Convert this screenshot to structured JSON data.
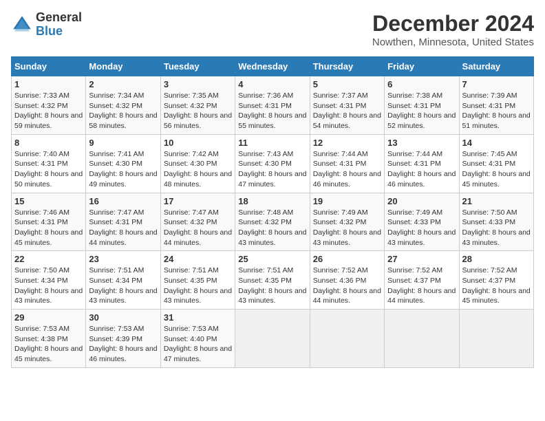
{
  "logo": {
    "general": "General",
    "blue": "Blue"
  },
  "title": "December 2024",
  "subtitle": "Nowthen, Minnesota, United States",
  "calendar": {
    "headers": [
      "Sunday",
      "Monday",
      "Tuesday",
      "Wednesday",
      "Thursday",
      "Friday",
      "Saturday"
    ],
    "weeks": [
      [
        {
          "day": "1",
          "sunrise": "7:33 AM",
          "sunset": "4:32 PM",
          "daylight": "8 hours and 59 minutes."
        },
        {
          "day": "2",
          "sunrise": "7:34 AM",
          "sunset": "4:32 PM",
          "daylight": "8 hours and 58 minutes."
        },
        {
          "day": "3",
          "sunrise": "7:35 AM",
          "sunset": "4:32 PM",
          "daylight": "8 hours and 56 minutes."
        },
        {
          "day": "4",
          "sunrise": "7:36 AM",
          "sunset": "4:31 PM",
          "daylight": "8 hours and 55 minutes."
        },
        {
          "day": "5",
          "sunrise": "7:37 AM",
          "sunset": "4:31 PM",
          "daylight": "8 hours and 54 minutes."
        },
        {
          "day": "6",
          "sunrise": "7:38 AM",
          "sunset": "4:31 PM",
          "daylight": "8 hours and 52 minutes."
        },
        {
          "day": "7",
          "sunrise": "7:39 AM",
          "sunset": "4:31 PM",
          "daylight": "8 hours and 51 minutes."
        }
      ],
      [
        {
          "day": "8",
          "sunrise": "7:40 AM",
          "sunset": "4:31 PM",
          "daylight": "8 hours and 50 minutes."
        },
        {
          "day": "9",
          "sunrise": "7:41 AM",
          "sunset": "4:30 PM",
          "daylight": "8 hours and 49 minutes."
        },
        {
          "day": "10",
          "sunrise": "7:42 AM",
          "sunset": "4:30 PM",
          "daylight": "8 hours and 48 minutes."
        },
        {
          "day": "11",
          "sunrise": "7:43 AM",
          "sunset": "4:30 PM",
          "daylight": "8 hours and 47 minutes."
        },
        {
          "day": "12",
          "sunrise": "7:44 AM",
          "sunset": "4:31 PM",
          "daylight": "8 hours and 46 minutes."
        },
        {
          "day": "13",
          "sunrise": "7:44 AM",
          "sunset": "4:31 PM",
          "daylight": "8 hours and 46 minutes."
        },
        {
          "day": "14",
          "sunrise": "7:45 AM",
          "sunset": "4:31 PM",
          "daylight": "8 hours and 45 minutes."
        }
      ],
      [
        {
          "day": "15",
          "sunrise": "7:46 AM",
          "sunset": "4:31 PM",
          "daylight": "8 hours and 45 minutes."
        },
        {
          "day": "16",
          "sunrise": "7:47 AM",
          "sunset": "4:31 PM",
          "daylight": "8 hours and 44 minutes."
        },
        {
          "day": "17",
          "sunrise": "7:47 AM",
          "sunset": "4:32 PM",
          "daylight": "8 hours and 44 minutes."
        },
        {
          "day": "18",
          "sunrise": "7:48 AM",
          "sunset": "4:32 PM",
          "daylight": "8 hours and 43 minutes."
        },
        {
          "day": "19",
          "sunrise": "7:49 AM",
          "sunset": "4:32 PM",
          "daylight": "8 hours and 43 minutes."
        },
        {
          "day": "20",
          "sunrise": "7:49 AM",
          "sunset": "4:33 PM",
          "daylight": "8 hours and 43 minutes."
        },
        {
          "day": "21",
          "sunrise": "7:50 AM",
          "sunset": "4:33 PM",
          "daylight": "8 hours and 43 minutes."
        }
      ],
      [
        {
          "day": "22",
          "sunrise": "7:50 AM",
          "sunset": "4:34 PM",
          "daylight": "8 hours and 43 minutes."
        },
        {
          "day": "23",
          "sunrise": "7:51 AM",
          "sunset": "4:34 PM",
          "daylight": "8 hours and 43 minutes."
        },
        {
          "day": "24",
          "sunrise": "7:51 AM",
          "sunset": "4:35 PM",
          "daylight": "8 hours and 43 minutes."
        },
        {
          "day": "25",
          "sunrise": "7:51 AM",
          "sunset": "4:35 PM",
          "daylight": "8 hours and 43 minutes."
        },
        {
          "day": "26",
          "sunrise": "7:52 AM",
          "sunset": "4:36 PM",
          "daylight": "8 hours and 44 minutes."
        },
        {
          "day": "27",
          "sunrise": "7:52 AM",
          "sunset": "4:37 PM",
          "daylight": "8 hours and 44 minutes."
        },
        {
          "day": "28",
          "sunrise": "7:52 AM",
          "sunset": "4:37 PM",
          "daylight": "8 hours and 45 minutes."
        }
      ],
      [
        {
          "day": "29",
          "sunrise": "7:53 AM",
          "sunset": "4:38 PM",
          "daylight": "8 hours and 45 minutes."
        },
        {
          "day": "30",
          "sunrise": "7:53 AM",
          "sunset": "4:39 PM",
          "daylight": "8 hours and 46 minutes."
        },
        {
          "day": "31",
          "sunrise": "7:53 AM",
          "sunset": "4:40 PM",
          "daylight": "8 hours and 47 minutes."
        },
        null,
        null,
        null,
        null
      ]
    ]
  }
}
